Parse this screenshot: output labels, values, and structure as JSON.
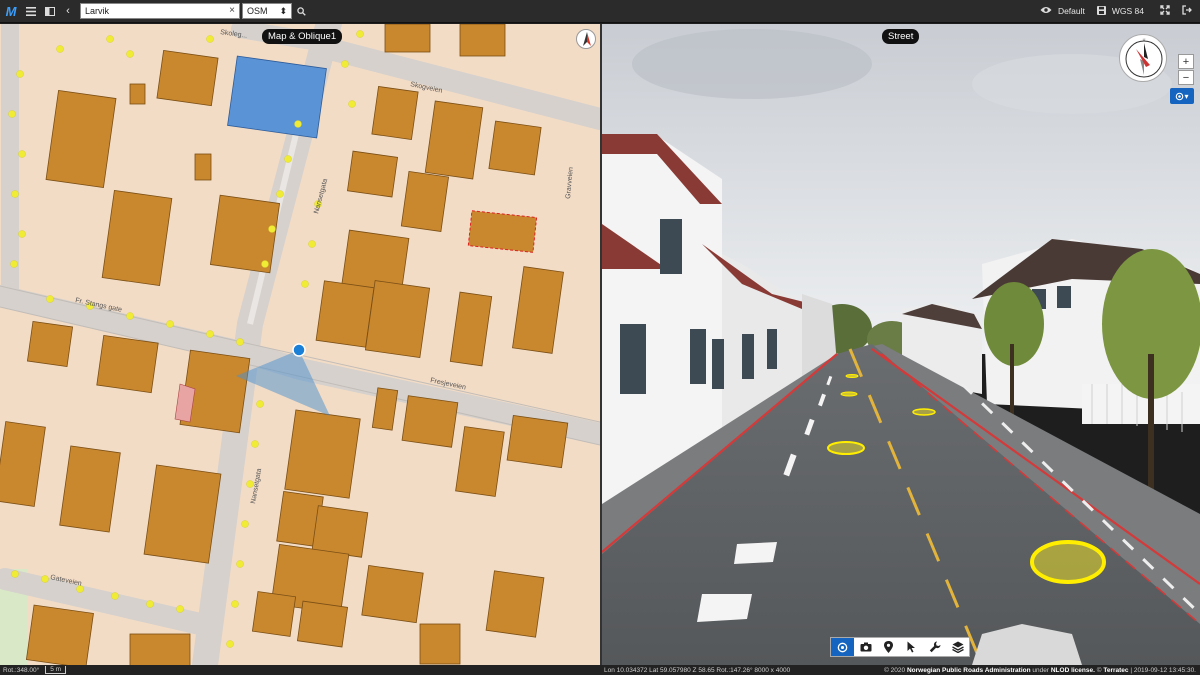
{
  "topbar": {
    "logo": "M",
    "search_value": "Larvik",
    "search_clear": "×",
    "layer": "OSM",
    "layer_arrow": "⬍",
    "profile": "Default",
    "crs": "WGS 84"
  },
  "map": {
    "label": "Map & Oblique1",
    "streets": [
      "Skoleg...",
      "Skogveien",
      "Nansetgata",
      "Gravveien",
      "Fr. Stangs gate",
      "Fresjeveien",
      "Nansetgata",
      "Gateveien"
    ]
  },
  "street": {
    "label": "Street",
    "zoom_in": "+",
    "zoom_out": "−",
    "locate_caret": "▾"
  },
  "status": {
    "rotation": "Rot.:348.00°",
    "scale": "5 m",
    "coords": "Lon 10.034372  Lat 59.057980  Z 58.65   Rot.:147.26°  8000 x 4000",
    "credit_prefix": "© 2020",
    "credit_org": "Norwegian Public Roads Administration",
    "credit_mid": "under",
    "credit_license": "NLOD license.",
    "credit_copy": "©",
    "credit_company": "Terratec",
    "credit_date": "| 2019-09-12 13:45:30."
  },
  "colors": {
    "accent": "#1565c0",
    "building": "#c9872e",
    "land": "#f2dcc7",
    "road": "#d8d2cc",
    "tree": "#f0ec35"
  }
}
